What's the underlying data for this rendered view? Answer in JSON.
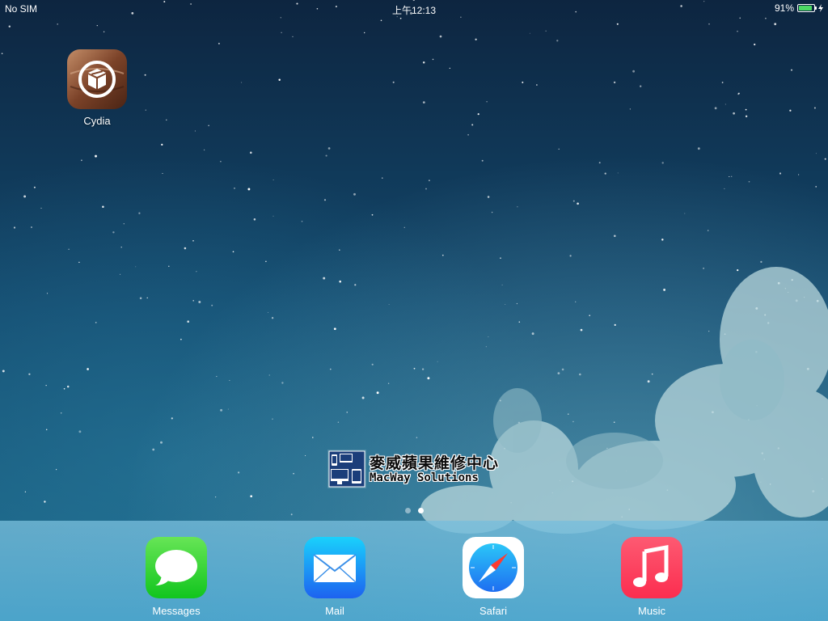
{
  "status_bar": {
    "carrier": "No SIM",
    "time": "上午12:13",
    "battery_percent": "91%",
    "battery_level": 0.91,
    "charging": true
  },
  "home": {
    "apps": [
      {
        "label": "Cydia",
        "icon": "cydia-icon"
      }
    ]
  },
  "watermark": {
    "line1": "麥威蘋果維修中心",
    "line2": "MacWay Solutions"
  },
  "page_dots": {
    "count": 2,
    "active_index": 1
  },
  "dock": {
    "apps": [
      {
        "label": "Messages",
        "icon": "messages-icon"
      },
      {
        "label": "Mail",
        "icon": "mail-icon"
      },
      {
        "label": "Safari",
        "icon": "safari-icon"
      },
      {
        "label": "Music",
        "icon": "music-icon"
      }
    ]
  },
  "colors": {
    "battery_green": "#4cd964",
    "messages_green": "#34c94a",
    "mail_blue": "#1e8ef0",
    "music_red": "#fc3158"
  }
}
